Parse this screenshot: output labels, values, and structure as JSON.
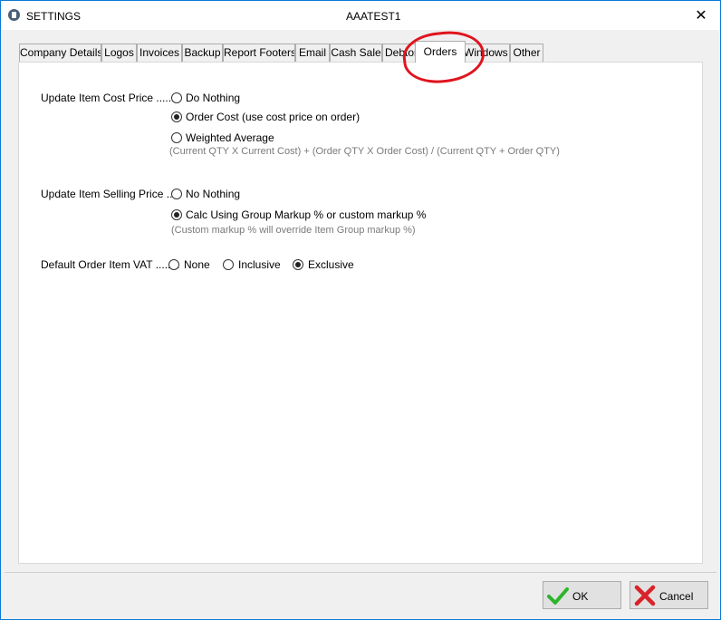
{
  "window": {
    "title": "SETTINGS",
    "subtitle": "AAATEST1",
    "close_glyph": "✕"
  },
  "tabs": [
    {
      "label": "Company Details"
    },
    {
      "label": "Logos"
    },
    {
      "label": "Invoices"
    },
    {
      "label": "Backup"
    },
    {
      "label": "Report Footers"
    },
    {
      "label": "Email"
    },
    {
      "label": "Cash Sale"
    },
    {
      "label": "Debtor"
    },
    {
      "label": "Orders",
      "active": true
    },
    {
      "label": "Windows"
    },
    {
      "label": "Other"
    }
  ],
  "orders": {
    "cost_price": {
      "label": "Update Item Cost Price ........",
      "options": [
        {
          "label": "Do Nothing",
          "checked": false
        },
        {
          "label": "Order Cost (use cost price on order)",
          "checked": true
        },
        {
          "label": "Weighted Average",
          "checked": false
        }
      ],
      "note": "(Current QTY  X  Current Cost) + (Order QTY  X  Order Cost) / (Current QTY  +  Order QTY)"
    },
    "selling_price": {
      "label": "Update Item Selling Price .....",
      "options": [
        {
          "label": "No Nothing",
          "checked": false
        },
        {
          "label": "Calc Using Group Markup % or custom markup %",
          "checked": true
        }
      ],
      "note": "(Custom markup % will override Item Group markup %)"
    },
    "vat": {
      "label": "Default Order Item VAT ........",
      "options": [
        {
          "label": "None",
          "checked": false
        },
        {
          "label": "Inclusive",
          "checked": false
        },
        {
          "label": "Exclusive",
          "checked": true
        }
      ]
    }
  },
  "buttons": {
    "ok_label": "OK",
    "cancel_label": "Cancel"
  },
  "colors": {
    "window_border": "#0a78d7",
    "annotation": "#e0141e",
    "ok_check": "#2db52d",
    "cancel_x": "#d8232a"
  }
}
